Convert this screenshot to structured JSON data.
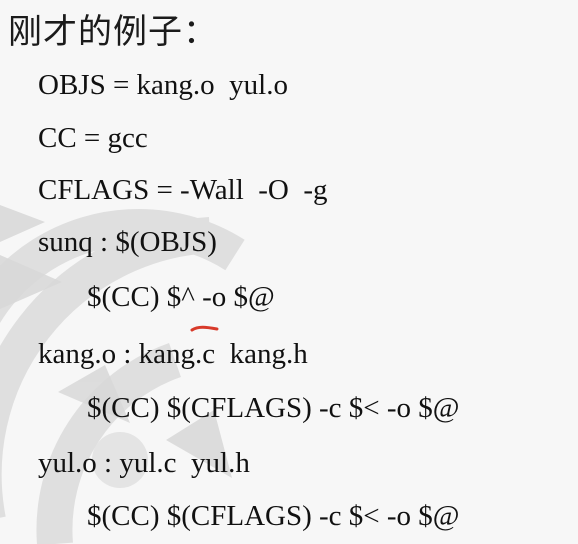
{
  "slide": {
    "title": "刚才的例子：",
    "code_lines": [
      "OBJS = kang.o  yul.o",
      "CC = gcc",
      "CFLAGS = -Wall  -O  -g",
      "sunq : $(OBJS)",
      "$(CC) $^ -o $@",
      "kang.o : kang.c  kang.h",
      "$(CC) $(CFLAGS) -c $< -o $@",
      "yul.o : yul.c  yul.h",
      "$(CC) $(CFLAGS) -c $< -o $@"
    ]
  },
  "colors": {
    "background": "#f7f7f7",
    "watermark": "#d8d8d8",
    "text": "#111111",
    "annotation": "#d83a2a"
  },
  "icons": {
    "background": "concentric-arc-watermark",
    "annotation": "red-underline-mark"
  }
}
